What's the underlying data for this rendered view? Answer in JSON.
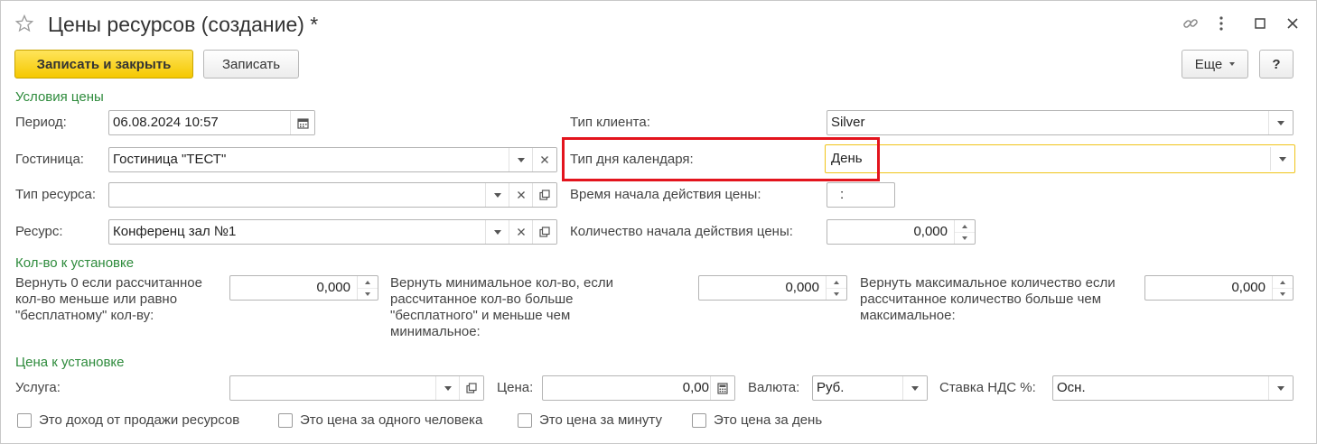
{
  "window": {
    "title": "Цены ресурсов (создание) *",
    "star_icon": "star-icon",
    "link_icon": "link-icon",
    "more_icon": "more-vertical-icon",
    "maximize_icon": "maximize-icon",
    "close_icon": "close-icon"
  },
  "toolbar": {
    "save_close_label": "Записать и закрыть",
    "save_label": "Записать",
    "more_label": "Еще",
    "help_label": "?"
  },
  "price_conditions": {
    "section_title": "Условия цены",
    "period_label": "Период:",
    "period_value": "06.08.2024 10:57",
    "hotel_label": "Гостиница:",
    "hotel_value": "Гостиница \"ТЕСТ\"",
    "resource_type_label": "Тип ресурса:",
    "resource_type_value": "",
    "resource_label": "Ресурс:",
    "resource_value": "Конференц зал №1",
    "client_type_label": "Тип клиента:",
    "client_type_value": "Silver",
    "calendar_day_type_label": "Тип дня календаря:",
    "calendar_day_type_value": "День",
    "start_time_label": "Время начала действия цены:",
    "start_time_value": ":",
    "start_qty_label": "Количество начала действия цены:",
    "start_qty_value": "0,000"
  },
  "qty_setup": {
    "section_title": "Кол-во к установке",
    "return_zero_label": "Вернуть 0 если рассчитанное кол-во меньше или равно \"бесплатному\" кол-ву:",
    "return_zero_value": "0,000",
    "return_min_label": "Вернуть минимальное кол-во, если рассчитанное кол-во больше \"бесплатного\" и меньше чем минимальное:",
    "return_min_value": "0,000",
    "return_max_label": "Вернуть максимальное количество если рассчитанное количество больше чем максимальное:",
    "return_max_value": "0,000"
  },
  "price_setup": {
    "section_title": "Цена к установке",
    "service_label": "Услуга:",
    "service_value": "",
    "price_label": "Цена:",
    "price_value": "0,00",
    "currency_label": "Валюта:",
    "currency_value": "Руб.",
    "vat_label": "Ставка НДС %:",
    "vat_value": "Осн."
  },
  "checkboxes": [
    {
      "label": "Это доход от продажи ресурсов",
      "checked": false
    },
    {
      "label": "Это цена за одного человека",
      "checked": false
    },
    {
      "label": "Это цена за минуту",
      "checked": false
    },
    {
      "label": "Это цена за день",
      "checked": false
    }
  ],
  "colors": {
    "accent_yellow": "#f5c800",
    "section_green": "#2e8b3c",
    "highlight_red": "#e3141d",
    "focus_border": "#f0c419"
  }
}
